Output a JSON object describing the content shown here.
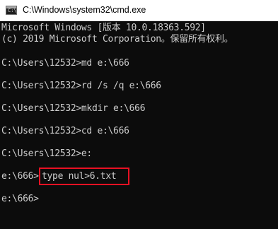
{
  "window": {
    "title": "C:\\Windows\\system32\\cmd.exe"
  },
  "console": {
    "lines": [
      "Microsoft Windows [版本 10.0.18363.592]",
      "(c) 2019 Microsoft Corporation。保留所有权利。",
      "C:\\Users\\12532>md e:\\666",
      "C:\\Users\\12532>rd /s /q e:\\666",
      "C:\\Users\\12532>mkdir e:\\666",
      "C:\\Users\\12532>cd e:\\666",
      "C:\\Users\\12532>e:",
      "e:\\666>",
      "type nul>6.txt",
      "e:\\666>"
    ]
  },
  "colors": {
    "console_bg": "#0c0c0c",
    "console_text": "#cccccc",
    "highlight_border": "#e81123",
    "titlebar_bg": "#ffffff"
  },
  "icons": {
    "app": "cmd-icon"
  }
}
